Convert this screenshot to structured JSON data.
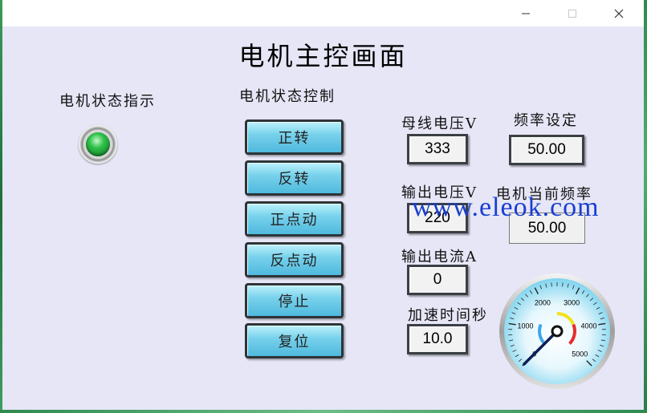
{
  "main": {
    "title": "电机主控画面",
    "status_label": "电机状态指示",
    "control_label": "电机状态控制",
    "status_lamp_color": "#2fc24a"
  },
  "buttons": [
    "正转",
    "反转",
    "正点动",
    "反点动",
    "停止",
    "复位"
  ],
  "fields": {
    "bus_voltage": {
      "label": "母线电压V",
      "value": "333"
    },
    "freq_setting": {
      "label": "频率设定",
      "value": "50.00"
    },
    "output_voltage": {
      "label": "输出电压V",
      "value": "220"
    },
    "current_freq": {
      "label": "电机当前频率",
      "value": "50.00"
    },
    "output_current": {
      "label": "输出电流A",
      "value": "0"
    },
    "accel_time": {
      "label": "加速时间秒",
      "value": "10.0"
    }
  },
  "gauge": {
    "min": 0,
    "max": 5000,
    "ticks": [
      "0",
      "1000",
      "2000",
      "3000",
      "4000",
      "5000"
    ],
    "value": 0,
    "zones": [
      {
        "from": 0,
        "to": 1250,
        "color": "#3fa6ea"
      },
      {
        "from": 2500,
        "to": 3750,
        "color": "#f2e21a"
      },
      {
        "from": 3750,
        "to": 5000,
        "color": "#e52d2d"
      }
    ]
  },
  "watermark": "www.eleok.com"
}
